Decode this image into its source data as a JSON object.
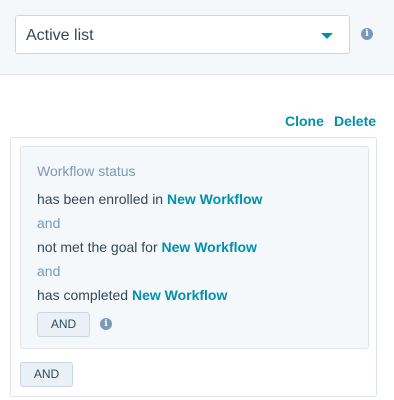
{
  "list_type_select": {
    "value": "Active list",
    "caret_icon": "chevron-down-icon",
    "info_icon": "info-icon"
  },
  "actions": {
    "clone_label": "Clone",
    "delete_label": "Delete"
  },
  "filter_group": {
    "title": "Workflow status",
    "conditions": [
      {
        "text": "has been enrolled in ",
        "workflow": "New Workflow"
      },
      {
        "text": "not met the goal for ",
        "workflow": "New Workflow"
      },
      {
        "text": "has completed ",
        "workflow": "New Workflow"
      }
    ],
    "separator": "and",
    "and_button_label": "AND",
    "info_icon": "info-icon"
  },
  "outer_and_button_label": "AND",
  "colors": {
    "accent": "#0091ae",
    "muted": "#7c98b6",
    "text": "#33475b",
    "border": "#dfe3eb",
    "panel_bg": "#f5f8fa"
  }
}
